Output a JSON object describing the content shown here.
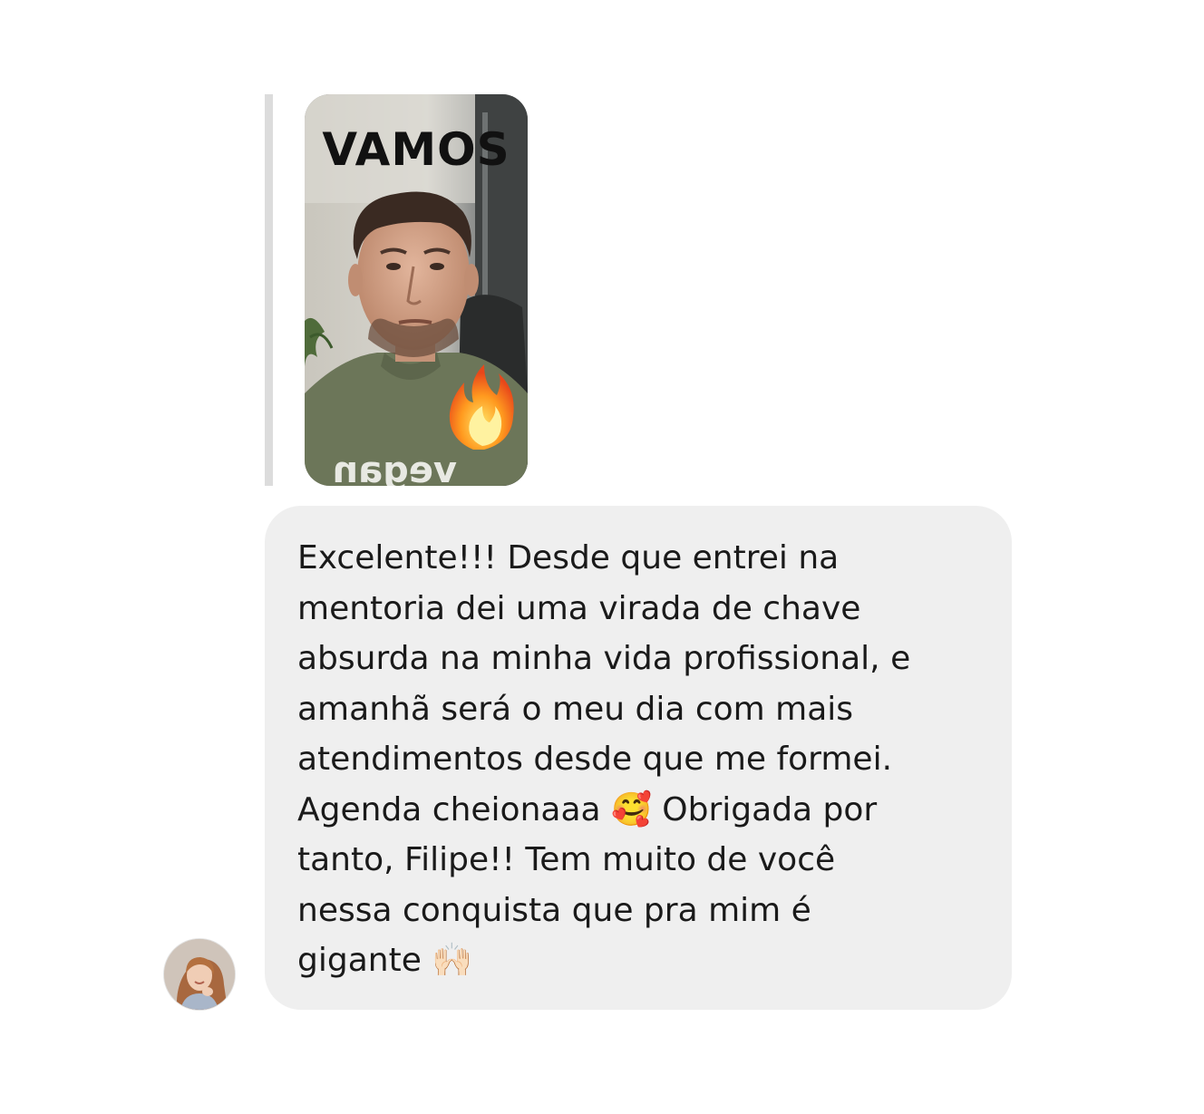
{
  "story_reply": {
    "caption": "VAMOS",
    "shirt_text": "vegan",
    "sticker_icon": "fire-emoji-icon"
  },
  "message": {
    "text": "Excelente!!! Desde que entrei na\nmentoria dei uma virada de chave\nabsurda na minha vida profissional, e\namanhã será o meu dia com mais\natendimentos desde que me formei.\nAgenda cheionaaa 🥰 Obrigada por\ntanto, Filipe!! Tem muito de você\nnessa conquista que pra mim é\ngigante 🙌🏻"
  },
  "sender": {
    "avatar_icon": "user-avatar-icon"
  },
  "colors": {
    "bubble_background": "#efefef",
    "reply_bar": "#dcdcdc",
    "text": "#1a1a1a"
  }
}
